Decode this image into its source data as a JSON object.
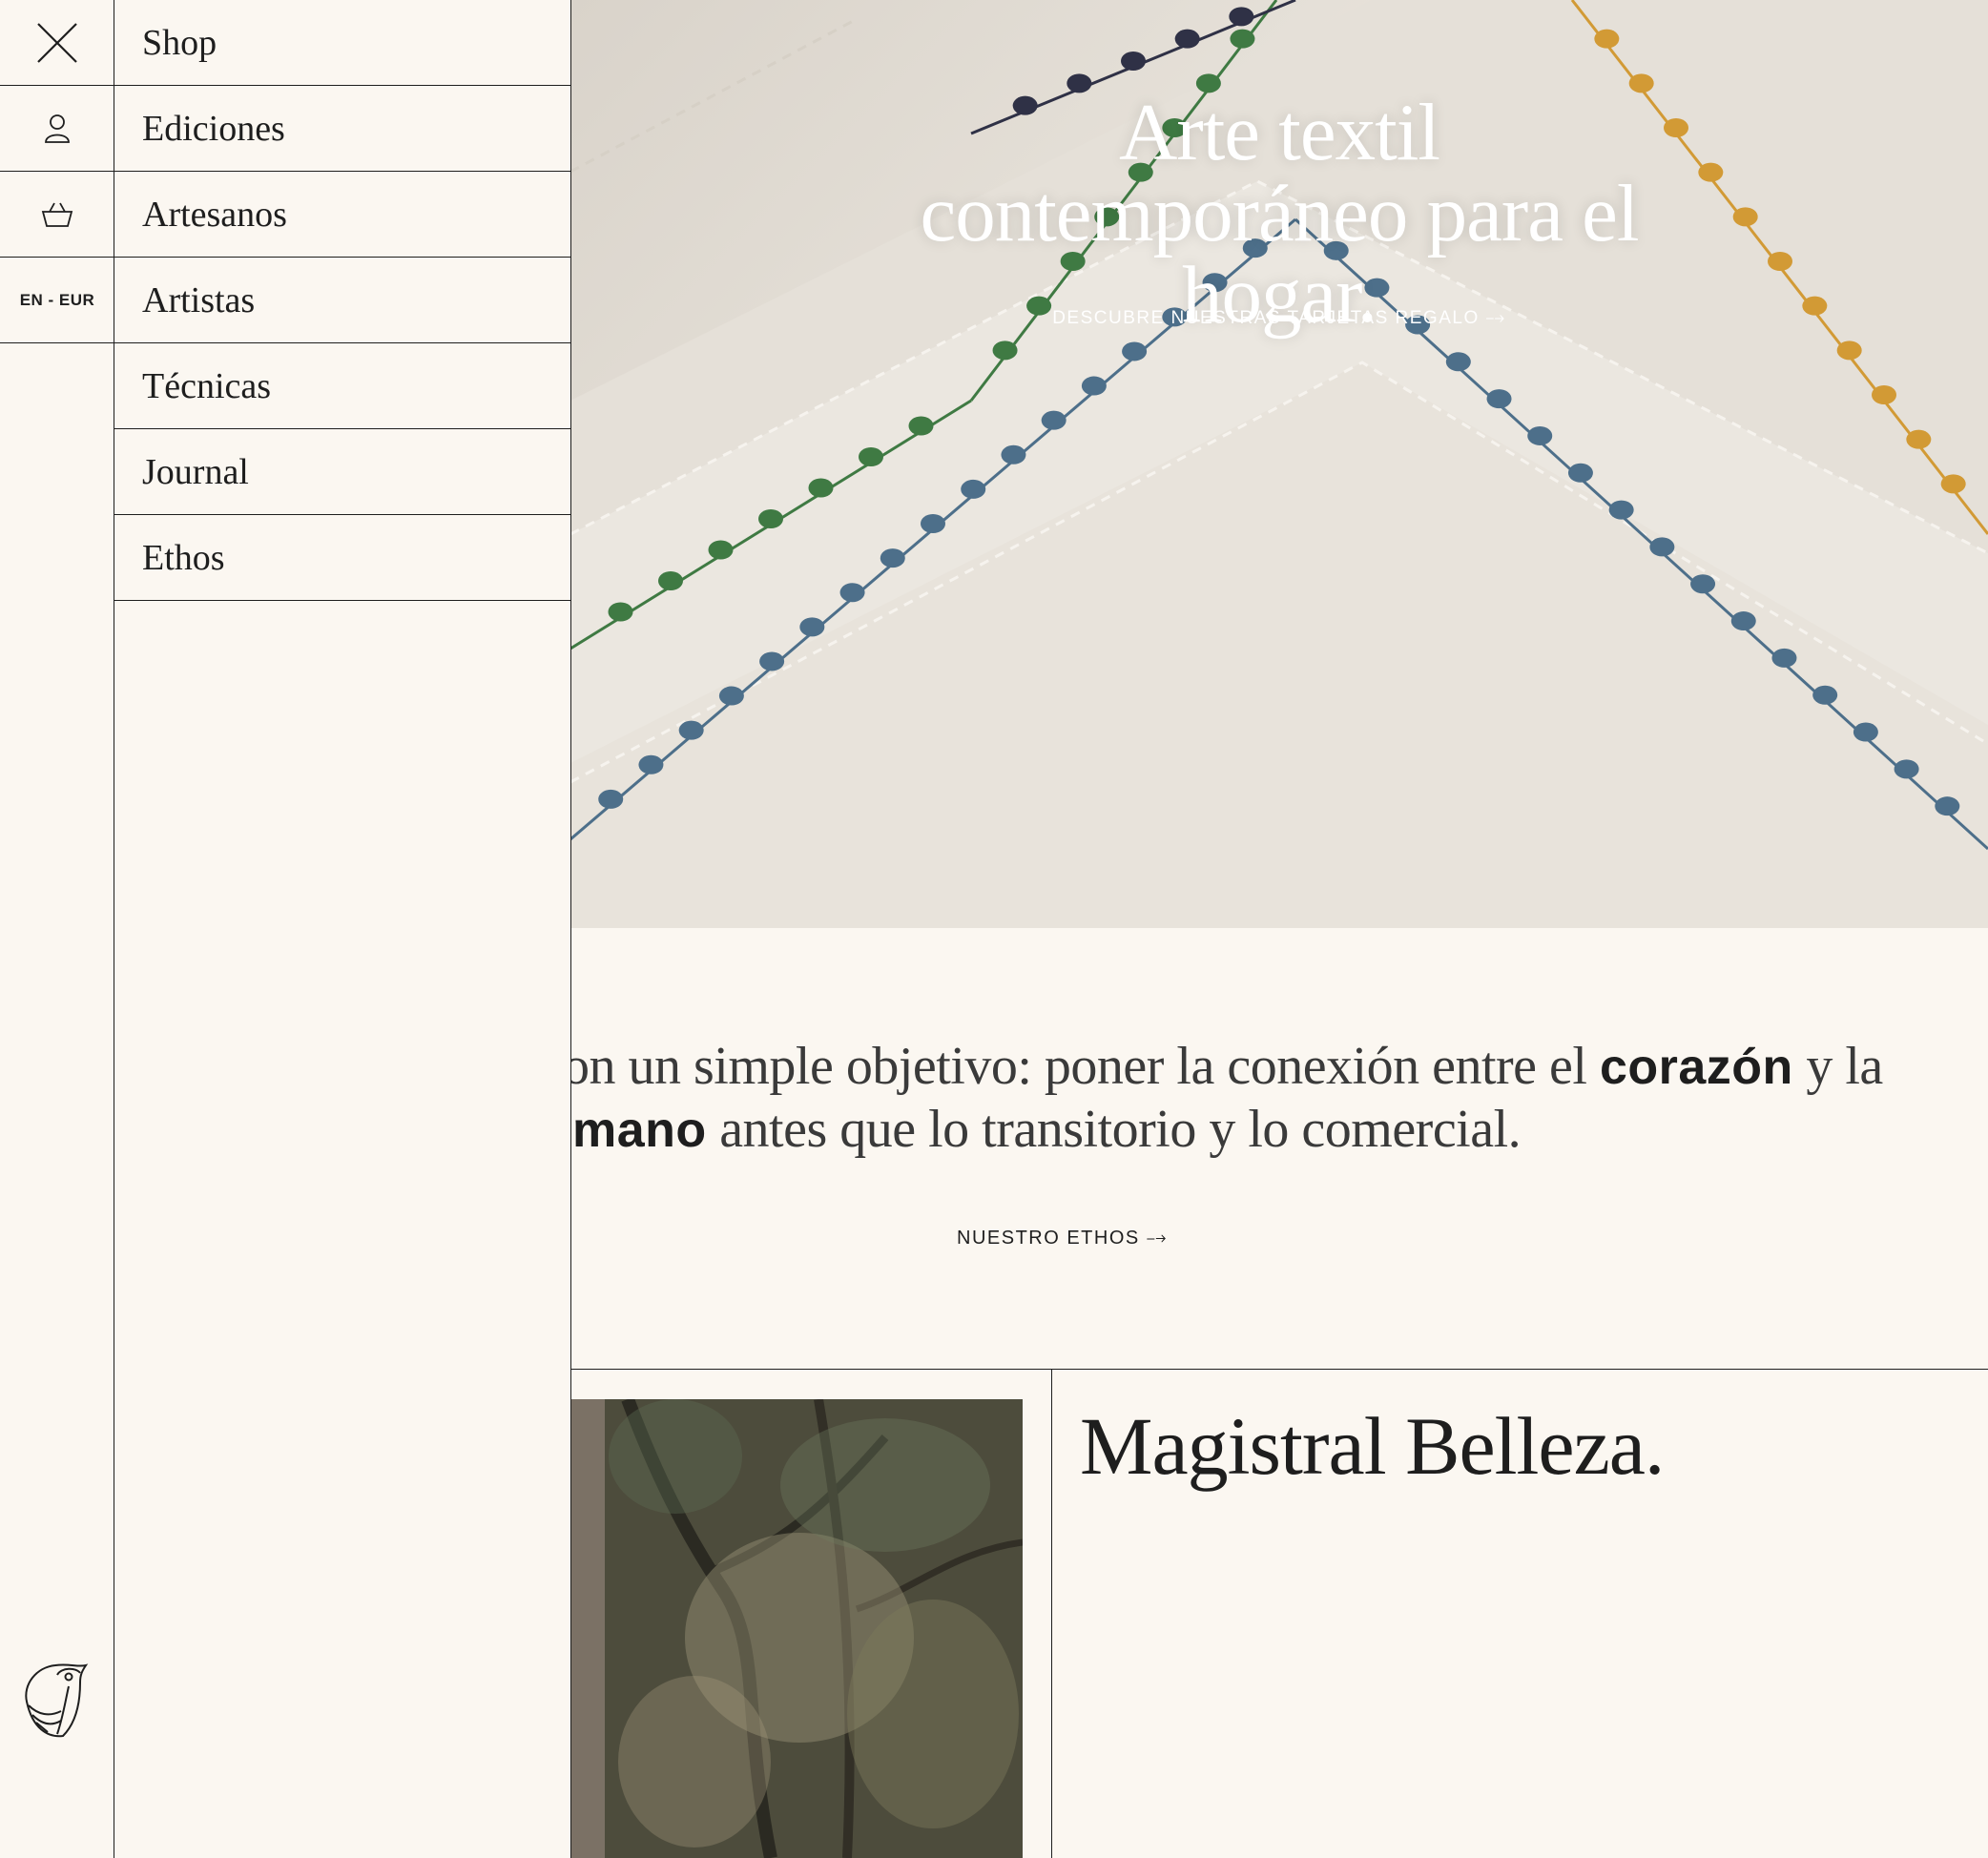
{
  "hero": {
    "title_lines": [
      "Arte textil",
      "contemporáneo para el",
      "hogar."
    ],
    "link": "DESCUBRE NUESTRAS TARJETAS REGALO ⤍"
  },
  "statement": {
    "line1_start": "on un simple objetivo: poner la conexión entre el ",
    "line1_bold": "corazón",
    "line1_end": " y la",
    "line2_bold": "mano",
    "line2_end": " antes que lo transitorio y lo comercial.",
    "link": "NUESTRO ETHOS ⤍"
  },
  "feature": {
    "title": "Magistral Belleza."
  },
  "menu": {
    "rail": {
      "close_icon": "close-icon",
      "account_icon": "user-icon",
      "cart_icon": "basket-icon",
      "lang_currency": "EN - EUR",
      "logo_icon": "bird-logo-icon"
    },
    "items": [
      {
        "label": "Shop"
      },
      {
        "label": "Ediciones"
      },
      {
        "label": "Artesanos"
      },
      {
        "label": "Artistas"
      },
      {
        "label": "Técnicas"
      },
      {
        "label": "Journal"
      },
      {
        "label": "Ethos"
      }
    ]
  },
  "colors": {
    "background": "#fbf7f1",
    "text": "#1e1e1e",
    "stitch_green": "#3f7a43",
    "stitch_blue": "#4d6f8a",
    "stitch_navy": "#2f3146",
    "stitch_ochre": "#d29a35"
  }
}
